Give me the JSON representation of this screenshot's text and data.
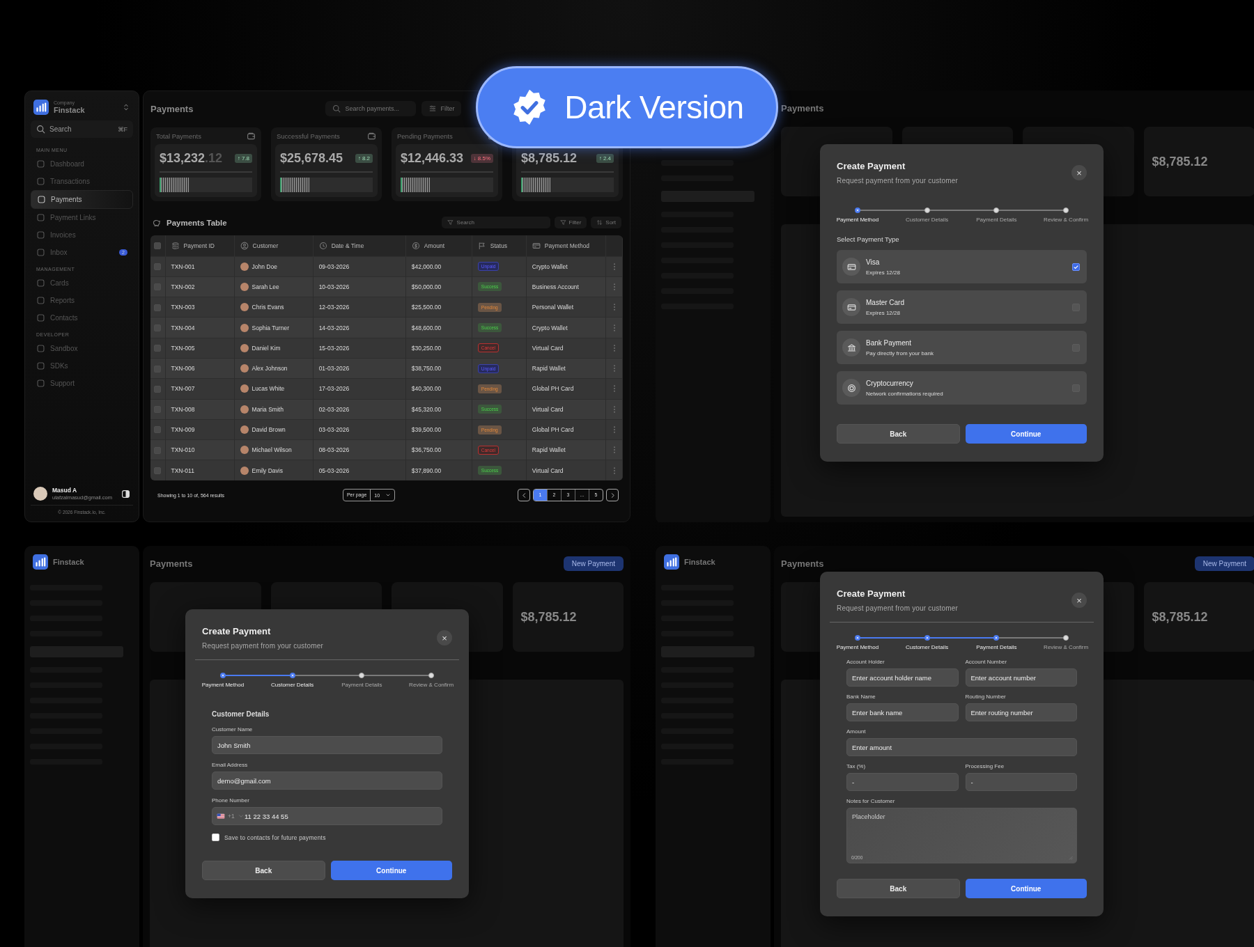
{
  "badge": {
    "label": "Dark Version"
  },
  "dashboard": {
    "sidebar": {
      "company_label": "Company",
      "brand": "Finstack",
      "search": {
        "placeholder": "Search",
        "shortcut": "⌘F"
      },
      "sections": [
        {
          "title": "MAIN MENU",
          "items": [
            {
              "label": "Dashboard",
              "selected": false
            },
            {
              "label": "Transactions",
              "selected": false
            },
            {
              "label": "Payments",
              "selected": true
            },
            {
              "label": "Payment Links",
              "selected": false
            },
            {
              "label": "Invoices",
              "selected": false
            },
            {
              "label": "Inbox",
              "selected": false,
              "count": "2"
            }
          ]
        },
        {
          "title": "MANAGEMENT",
          "items": [
            {
              "label": "Cards",
              "selected": false
            },
            {
              "label": "Reports",
              "selected": false
            },
            {
              "label": "Contacts",
              "selected": false
            }
          ]
        },
        {
          "title": "DEVELOPER",
          "items": [
            {
              "label": "Sandbox",
              "selected": false
            },
            {
              "label": "SDKs",
              "selected": false
            },
            {
              "label": "Support",
              "selected": false
            }
          ]
        }
      ],
      "user": {
        "name": "Masud A",
        "email": "ulafzalmasud@gmail.com"
      },
      "copyright": "© 2026 Finstack.Io, Inc."
    },
    "header": {
      "title": "Payments",
      "search_placeholder": "Search payments...",
      "filter": "Filter"
    },
    "stats": [
      {
        "title": "Total Payments",
        "value": "$13,232",
        "cents": ".12",
        "trend": "↑ 7.8",
        "kind": "up",
        "level": 0.3
      },
      {
        "title": "Successful Payments",
        "value": "$25,678.45",
        "trend": "↑ 8.2",
        "kind": "up",
        "level": 0.3
      },
      {
        "title": "Pending Payments",
        "value": "$12,446.33",
        "trend": "↓ 8.5%",
        "kind": "down",
        "level": 0.3
      },
      {
        "value": "$8,785.12",
        "trend": "↑ 2.4",
        "kind": "up",
        "level": 0.3
      }
    ],
    "table": {
      "title": "Payments Table",
      "search_placeholder": "Search",
      "filter": "Filter",
      "sort": "Sort",
      "select_all_checked": false,
      "columns": [
        "Payment ID",
        "Customer",
        "Date & Time",
        "Amount",
        "Status",
        "Payment Method"
      ],
      "rows": [
        {
          "checked": false,
          "id": "TXN-001",
          "customer": "John Doe",
          "date": "09-03-2026",
          "amount": "$42,000.00",
          "status": {
            "label": "Unpaid",
            "kind": "unpaid"
          },
          "method": "Crypto Wallet"
        },
        {
          "checked": false,
          "id": "TXN-002",
          "customer": "Sarah Lee",
          "date": "10-03-2026",
          "amount": "$50,000.00",
          "status": {
            "label": "Success",
            "kind": "success"
          },
          "method": "Business Account"
        },
        {
          "checked": false,
          "id": "TXN-003",
          "customer": "Chris Evans",
          "date": "12-03-2026",
          "amount": "$25,500.00",
          "status": {
            "label": "Pending",
            "kind": "pending"
          },
          "method": "Personal Wallet"
        },
        {
          "checked": false,
          "id": "TXN-004",
          "customer": "Sophia Turner",
          "date": "14-03-2026",
          "amount": "$48,600.00",
          "status": {
            "label": "Success",
            "kind": "success"
          },
          "method": "Crypto Wallet"
        },
        {
          "checked": false,
          "id": "TXN-005",
          "customer": "Daniel Kim",
          "date": "15-03-2026",
          "amount": "$30,250.00",
          "status": {
            "label": "Cancel",
            "kind": "cancel"
          },
          "method": "Virtual Card"
        },
        {
          "checked": false,
          "id": "TXN-006",
          "customer": "Alex Johnson",
          "date": "01-03-2026",
          "amount": "$38,750.00",
          "status": {
            "label": "Unpaid",
            "kind": "unpaid"
          },
          "method": "Rapid Wallet"
        },
        {
          "checked": false,
          "id": "TXN-007",
          "customer": "Lucas White",
          "date": "17-03-2026",
          "amount": "$40,300.00",
          "status": {
            "label": "Pending",
            "kind": "pending"
          },
          "method": "Global PH Card"
        },
        {
          "checked": false,
          "id": "TXN-008",
          "customer": "Maria Smith",
          "date": "02-03-2026",
          "amount": "$45,320.00",
          "status": {
            "label": "Success",
            "kind": "success"
          },
          "method": "Virtual Card"
        },
        {
          "checked": false,
          "id": "TXN-009",
          "customer": "David Brown",
          "date": "03-03-2026",
          "amount": "$39,500.00",
          "status": {
            "label": "Pending",
            "kind": "pending"
          },
          "method": "Global PH Card"
        },
        {
          "checked": false,
          "id": "TXN-010",
          "customer": "Michael Wilson",
          "date": "08-03-2026",
          "amount": "$36,750.00",
          "status": {
            "label": "Cancel",
            "kind": "cancel"
          },
          "method": "Rapid Wallet"
        },
        {
          "checked": false,
          "id": "TXN-011",
          "customer": "Emily Davis",
          "date": "05-03-2026",
          "amount": "$37,890.00",
          "status": {
            "label": "Success",
            "kind": "success"
          },
          "method": "Virtual Card"
        }
      ],
      "footer": {
        "summary": "Showing 1 to 10 of, 564 results",
        "per_page_label": "Per page",
        "per_page": "10",
        "pages": [
          {
            "label": "1",
            "selected": true
          },
          {
            "label": "2",
            "selected": false
          },
          {
            "label": "3",
            "selected": false
          },
          {
            "label": "...",
            "selected": false
          },
          {
            "label": "5",
            "selected": false
          }
        ]
      }
    }
  },
  "modal_screens": [
    {
      "backdrop": {
        "title": "Payments",
        "value": "$8,785.12"
      },
      "modal": {
        "kind": "payment_type",
        "title": "Create Payment",
        "subtitle": "Request payment from your customer",
        "close": "×",
        "steps": [
          {
            "label": "Payment Method",
            "active": true
          },
          {
            "label": "Customer Details",
            "active": false
          },
          {
            "label": "Payment Details",
            "active": false
          },
          {
            "label": "Review & Confirm",
            "active": false
          }
        ],
        "section_title": "Select Payment Type",
        "options": [
          {
            "kind": "card",
            "title": "Visa",
            "subtitle": "Expires 12/28",
            "checked": true
          },
          {
            "kind": "card",
            "title": "Master Card",
            "subtitle": "Expires 12/28",
            "checked": false
          },
          {
            "kind": "bank",
            "title": "Bank Payment",
            "subtitle": "Pay directly from your bank",
            "checked": false
          },
          {
            "kind": "crypto",
            "title": "Cryptocurrency",
            "subtitle": "Network confirmations required",
            "checked": false
          }
        ],
        "back": "Back",
        "continue": "Continue"
      }
    },
    {
      "backdrop": {
        "brand": "Finstack",
        "title": "Payments",
        "value": "$8,785.12",
        "new_button": "New Payment"
      },
      "modal": {
        "kind": "customer_details",
        "title": "Create Payment",
        "subtitle": "Request payment from your customer",
        "close": "×",
        "steps": [
          {
            "label": "Payment Method",
            "active": true
          },
          {
            "label": "Customer Details",
            "active": true
          },
          {
            "label": "Payment Details",
            "active": false
          },
          {
            "label": "Review & Confirm",
            "active": false
          }
        ],
        "section_title": "Customer Details",
        "fields": [
          {
            "kind": "full",
            "label": "Customer Name",
            "value": "John Smith"
          },
          {
            "kind": "full",
            "label": "Email Address",
            "value": "demo@gmail.com"
          },
          {
            "kind": "phone",
            "label": "Phone Number",
            "country_code": "+1",
            "value": "11 22 33 44 55"
          }
        ],
        "save_contact": {
          "label": "Save to contacts for future payments",
          "checked": false
        },
        "back": "Back",
        "continue": "Continue"
      }
    },
    {
      "backdrop": {
        "brand": "Finstack",
        "title": "Payments",
        "value": "$8,785.12",
        "new_button": "New Payment"
      },
      "modal": {
        "kind": "payment_details",
        "title": "Create Payment",
        "subtitle": "Request payment from your customer",
        "close": "×",
        "steps": [
          {
            "label": "Payment Method",
            "active": true
          },
          {
            "label": "Customer Details",
            "active": true
          },
          {
            "label": "Payment Details",
            "active": true
          },
          {
            "label": "Review & Confirm",
            "active": false
          }
        ],
        "fields": [
          {
            "kind": "half",
            "label": "Account Holder",
            "placeholder": "Enter account holder name"
          },
          {
            "kind": "half",
            "label": "Account Number",
            "placeholder": "Enter account number"
          },
          {
            "kind": "half",
            "label": "Bank Name",
            "placeholder": "Enter bank name"
          },
          {
            "kind": "half",
            "label": "Routing Number",
            "placeholder": "Enter routing number"
          },
          {
            "kind": "full",
            "label": "Amount",
            "placeholder": "Enter amount"
          },
          {
            "kind": "half",
            "label": "Tax (%)",
            "placeholder": "-"
          },
          {
            "kind": "half",
            "label": "Processing Fee",
            "placeholder": "-"
          },
          {
            "kind": "textarea",
            "label": "Notes for Customer",
            "placeholder": "Placeholder",
            "counter": "0/200"
          }
        ],
        "back": "Back",
        "continue": "Continue"
      }
    }
  ]
}
